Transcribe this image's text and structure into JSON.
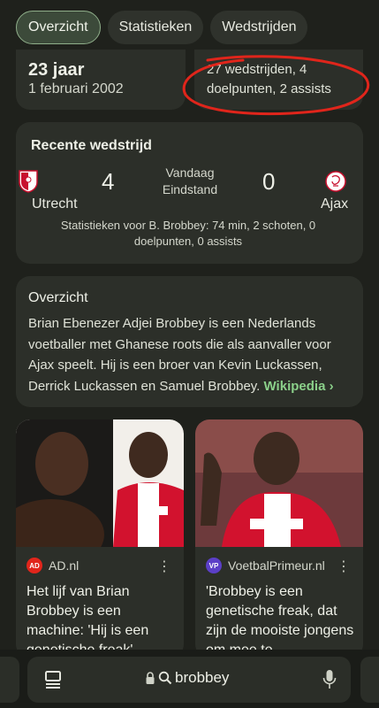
{
  "tabs": [
    {
      "label": "Overzicht",
      "active": true
    },
    {
      "label": "Statistieken",
      "active": false
    },
    {
      "label": "Wedstrijden",
      "active": false
    }
  ],
  "info": {
    "age": "23 jaar",
    "dob": "1 februari 2002",
    "stats": "27 wedstrijden, 4 doelpunten, 2 assists"
  },
  "match": {
    "title": "Recente wedstrijd",
    "home_team": "Utrecht",
    "home_score": "4",
    "away_team": "Ajax",
    "away_score": "0",
    "status_line1": "Vandaag",
    "status_line2": "Eindstand",
    "player_stats": "Statistieken voor B. Brobbey: 74 min, 2 schoten, 0 doelpunten, 0 assists"
  },
  "overview": {
    "title": "Overzicht",
    "text": "Brian Ebenezer Adjei Brobbey is een Nederlands voetballer met Ghanese roots die als aanvaller voor Ajax speelt. Hij is een broer van Kevin Luckassen, Derrick Luckassen en Samuel Brobbey.",
    "wiki_link": "Wikipedia ›"
  },
  "news": [
    {
      "source": "AD.nl",
      "source_icon_text": "AD",
      "headline": "Het lijf van Brian Brobbey is een machine: 'Hij is een genetische freak'"
    },
    {
      "source": "VoetbalPrimeur.nl",
      "source_icon_text": "VP",
      "headline": "'Brobbey is een genetische freak, dat zijn de mooiste jongens om mee te …"
    }
  ],
  "search": {
    "query": "brobbey"
  },
  "colors": {
    "accent_green": "#8bd08a",
    "annotation_red": "#e0251b",
    "ad_red": "#e1251b",
    "vp_purple": "#5b3fc7"
  }
}
